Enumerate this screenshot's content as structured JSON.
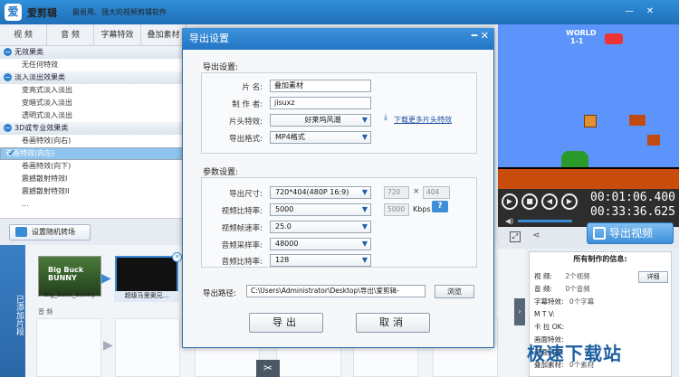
{
  "app": {
    "logo": "爱",
    "name": "爱剪辑",
    "slogan": "最易用、强大的视频剪辑软件"
  },
  "window_controls": {
    "minimize": "—",
    "close": "✕"
  },
  "tabs": [
    "视 频",
    "音 频",
    "字幕特效",
    "叠加素材"
  ],
  "effects": {
    "groups": [
      {
        "title": "无效果类",
        "items": [
          {
            "label": "无任何特效",
            "selected": false
          }
        ]
      },
      {
        "title": "淡入淡出效果类",
        "items": [
          {
            "label": "变亮式淡入淡出",
            "selected": false
          },
          {
            "label": "变暗式淡入淡出",
            "selected": false
          },
          {
            "label": "透明式淡入淡出",
            "selected": false
          }
        ]
      },
      {
        "title": "3D或专业效果类",
        "items": [
          {
            "label": "卷画特效(向右)",
            "selected": false
          },
          {
            "label": "卷画特效(向左)",
            "selected": true
          },
          {
            "label": "卷画特效(向下)",
            "selected": false
          },
          {
            "label": "震撼散射特效I",
            "selected": false
          },
          {
            "label": "震撼散射特效II",
            "selected": false
          },
          {
            "label": "...",
            "selected": false
          }
        ]
      }
    ]
  },
  "random_transition_button": "设置随机转场",
  "sidebar_label": "已添加片段",
  "clips": [
    {
      "label": "big_buck_bunny",
      "thumb_text": "Big Buck BUNNY"
    },
    {
      "label": "超级马里奥兄...",
      "thumb_text": ""
    }
  ],
  "audio_label": "音 频",
  "preview": {
    "world_label": "WORLD",
    "world_value": "1-1",
    "time_current": "00:01:06.400",
    "time_total": "00:33:36.625"
  },
  "export_video_button": "导出视频",
  "info_panel": {
    "title": "所有制作的信息:",
    "rows": [
      {
        "key": "视 频:",
        "value": "2个视频"
      },
      {
        "key": "音 频:",
        "value": "0个音频"
      },
      {
        "key": "字幕特效:",
        "value": "0个字幕"
      },
      {
        "key": "M T V:",
        "value": ""
      },
      {
        "key": "卡 拉 OK:",
        "value": ""
      },
      {
        "key": "画面特效:",
        "value": ""
      },
      {
        "key": "画面风格:",
        "value": ""
      },
      {
        "key": "叠加素材:",
        "value": "0个素材"
      }
    ],
    "detail_button": "详细"
  },
  "watermark": "极速下载站",
  "dialog": {
    "title": "导出设置",
    "close": "━ ✕",
    "section_export": "导出设置:",
    "name_label": "片 名:",
    "name_value": "叠加素材",
    "author_label": "制 作 者:",
    "author_value": "jisuxz",
    "intro_label": "片头特效:",
    "intro_value": "好莱坞风潮",
    "download_link": "下载更多片头特效",
    "format_label": "导出格式:",
    "format_value": "MP4格式",
    "section_params": "参数设置:",
    "size_label": "导出尺寸:",
    "size_value": "720*404(480P 16:9)",
    "width_value": "720",
    "times": "×",
    "height_value": "404",
    "vbitrate_label": "视频比特率:",
    "vbitrate_value": "5000",
    "vbitrate_custom": "5000",
    "kbps": "Kbps",
    "help": "?",
    "fps_label": "视频帧速率:",
    "fps_value": "25.0",
    "asample_label": "音频采样率:",
    "asample_value": "48000",
    "abitrate_label": "音频比特率:",
    "abitrate_value": "128",
    "path_label": "导出路径:",
    "path_value": "C:\\Users\\Administrator\\Desktop\\导出\\爱剪辑-",
    "browse_button": "浏览",
    "export_button": "导出",
    "cancel_button": "取消"
  }
}
